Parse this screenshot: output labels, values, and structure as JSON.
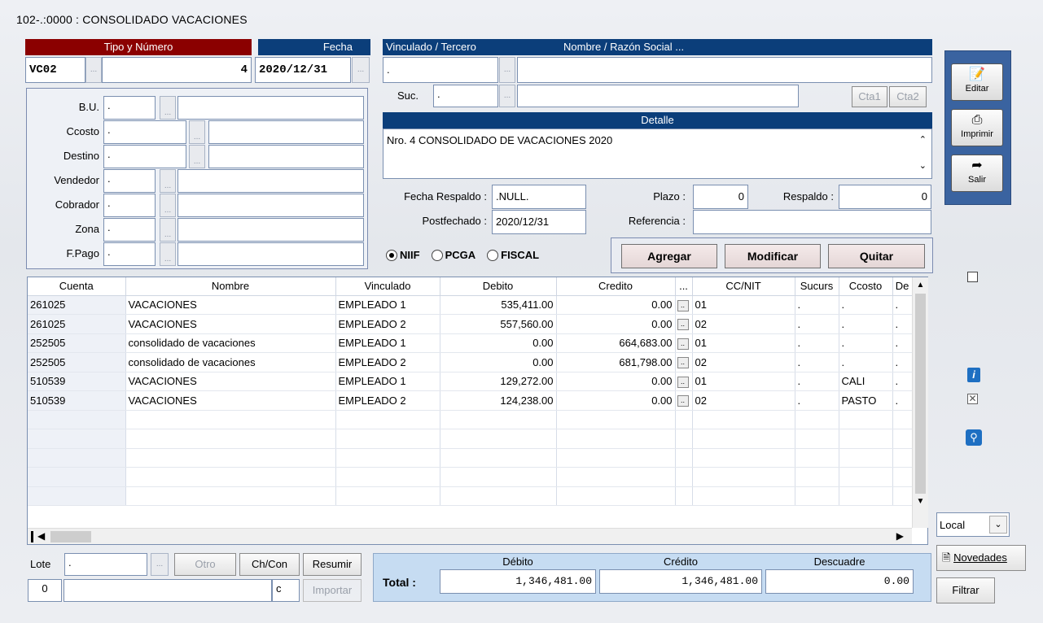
{
  "window": {
    "title": "102-.:0000 : CONSOLIDADO VACACIONES"
  },
  "tipo_numero": {
    "header": "Tipo y Número",
    "tipo": "VC02",
    "numero": "4"
  },
  "fecha": {
    "header": "Fecha",
    "value": "2020/12/31"
  },
  "vinculado": {
    "header_left": "Vinculado / Tercero",
    "header_right": "Nombre / Razón Social ...",
    "code": ".",
    "name": "",
    "suc_label": "Suc.",
    "suc_code": ".",
    "suc_name": "",
    "cta1": "Cta1",
    "cta2": "Cta2"
  },
  "detalle": {
    "header": "Detalle",
    "text": "Nro. 4 CONSOLIDADO DE VACACIONES 2020"
  },
  "left_fields": [
    {
      "label": "B.U.",
      "code": ".",
      "name": ""
    },
    {
      "label": "Ccosto",
      "code": ".",
      "name": ""
    },
    {
      "label": "Destino",
      "code": ".",
      "name": ""
    },
    {
      "label": "Vendedor",
      "code": ".",
      "name": ""
    },
    {
      "label": "Cobrador",
      "code": ".",
      "name": ""
    },
    {
      "label": "Zona",
      "code": ".",
      "name": ""
    },
    {
      "label": "F.Pago",
      "code": ".",
      "name": ""
    }
  ],
  "respaldo": {
    "fecha_respaldo_label": "Fecha Respaldo :",
    "fecha_respaldo": ".NULL.",
    "plazo_label": "Plazo :",
    "plazo": "0",
    "respaldo_label": "Respaldo :",
    "respaldo": "0",
    "postfechado_label": "Postfechado :",
    "postfechado": "2020/12/31",
    "referencia_label": "Referencia :",
    "referencia": ""
  },
  "radios": [
    {
      "label": "NIIF",
      "selected": true
    },
    {
      "label": "PCGA",
      "selected": false
    },
    {
      "label": "FISCAL",
      "selected": false
    }
  ],
  "actions": {
    "agregar": "Agregar",
    "modificar": "Modificar",
    "quitar": "Quitar"
  },
  "grid": {
    "columns": [
      "Cuenta",
      "Nombre",
      "Vinculado",
      "Debito",
      "Credito",
      "...",
      "CC/NIT",
      "Sucurs",
      "Ccosto",
      "De"
    ],
    "rows": [
      [
        "261025",
        "VACACIONES",
        "EMPLEADO 1",
        "535,411.00",
        "0.00",
        "..",
        "01",
        ".",
        ".",
        "."
      ],
      [
        "261025",
        "VACACIONES",
        "EMPLEADO 2",
        "557,560.00",
        "0.00",
        "..",
        "02",
        ".",
        ".",
        "."
      ],
      [
        "252505",
        "consolidado de vacaciones",
        "EMPLEADO 1",
        "0.00",
        "664,683.00",
        "..",
        "01",
        ".",
        ".",
        "."
      ],
      [
        "252505",
        "consolidado de vacaciones",
        "EMPLEADO 2",
        "0.00",
        "681,798.00",
        "..",
        "02",
        ".",
        ".",
        "."
      ],
      [
        "510539",
        "VACACIONES",
        "EMPLEADO 1",
        "129,272.00",
        "0.00",
        "..",
        "01",
        ".",
        "CALI",
        "."
      ],
      [
        "510539",
        "VACACIONES",
        "EMPLEADO 2",
        "124,238.00",
        "0.00",
        "..",
        "02",
        ".",
        "PASTO",
        "."
      ]
    ]
  },
  "bottom": {
    "lote_label": "Lote",
    "lote": ".",
    "otro": "Otro",
    "chcon": "Ch/Con",
    "resumir": "Resumir",
    "importar": "Importar",
    "field_num": "0",
    "field_text": "",
    "field_c": "c"
  },
  "totals": {
    "label": "Total :",
    "debito_label": "Débito",
    "credito_label": "Crédito",
    "descuadre_label": "Descuadre",
    "debito": "1,346,481.00",
    "credito": "1,346,481.00",
    "descuadre": "0.00"
  },
  "toolbar": {
    "editar": "Editar",
    "imprimir": "Imprimir",
    "salir": "Salir"
  },
  "side": {
    "local": "Local",
    "novedades": "Novedades",
    "filtrar": "Filtrar"
  }
}
